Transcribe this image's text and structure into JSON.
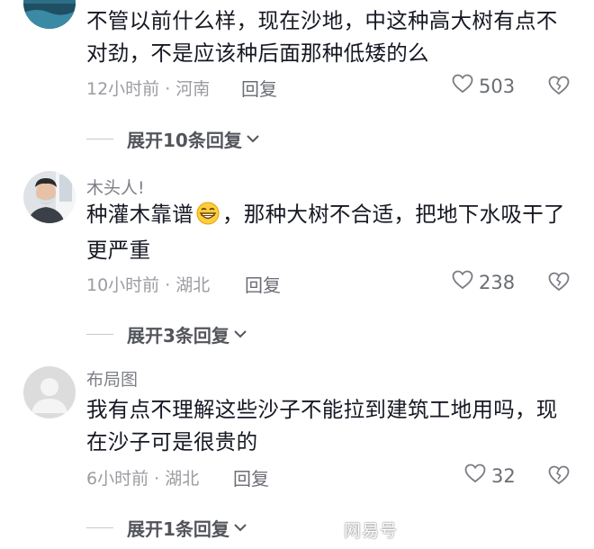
{
  "comments": [
    {
      "username": "",
      "text": "不管以前什么样，现在沙地，中这种高大树有点不对劲，不是应该种后面那种低矮的么",
      "meta": "12小时前 · 河南",
      "reply": "回复",
      "likes": "503",
      "expand": "展开10条回复"
    },
    {
      "username": "木头人!",
      "text_before_emoji": "种灌木靠谱",
      "text_after_emoji": "，那种大树不合适，把地下水吸干了更严重",
      "meta": "10小时前 · 湖北",
      "reply": "回复",
      "likes": "238",
      "expand": "展开3条回复"
    },
    {
      "username": "布局图",
      "text": "我有点不理解这些沙子不能拉到建筑工地用吗，现在沙子可是很贵的",
      "meta": "6小时前 · 湖北",
      "reply": "回复",
      "likes": "32",
      "expand": "展开1条回复"
    }
  ],
  "icons": {
    "like": "heart-outline-icon",
    "dislike": "broken-heart-icon",
    "expand": "chevron-down-icon",
    "emoji": "grinning-emoji"
  },
  "watermark": "网易号"
}
